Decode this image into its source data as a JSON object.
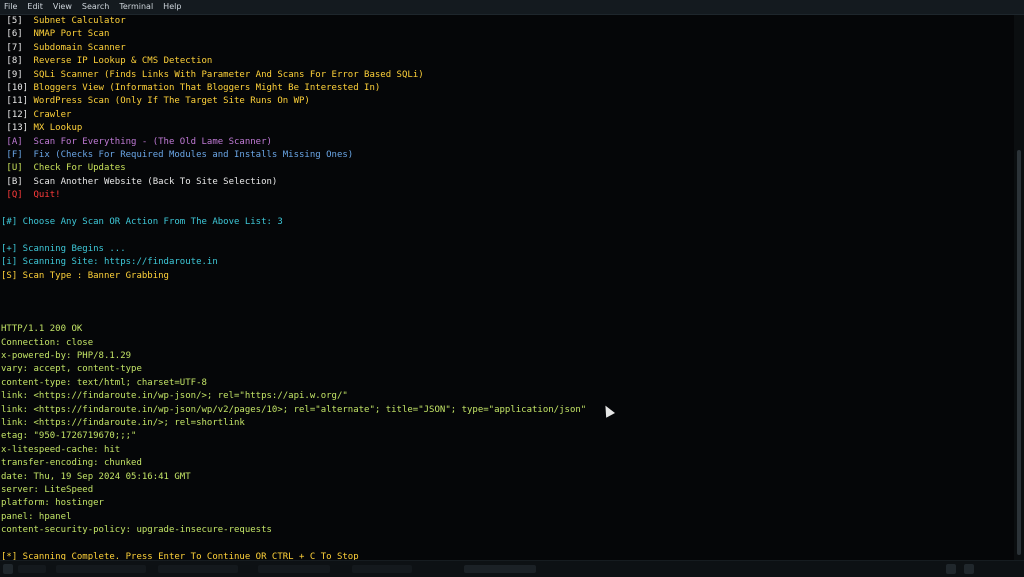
{
  "menubar": {
    "items": [
      "File",
      "Edit",
      "View",
      "Search",
      "Terminal",
      "Help"
    ]
  },
  "terminal": {
    "lines": [
      {
        "text": " [5]  Subnet Calculator",
        "color": "white-yellow"
      },
      {
        "text": " [6]  NMAP Port Scan",
        "color": "white-yellow"
      },
      {
        "text": " [7]  Subdomain Scanner",
        "color": "white-yellow"
      },
      {
        "text": " [8]  Reverse IP Lookup & CMS Detection",
        "color": "white-yellow"
      },
      {
        "text": " [9]  SQLi Scanner (Finds Links With Parameter And Scans For Error Based SQLi)",
        "color": "white-yellow"
      },
      {
        "text": " [10] Bloggers View (Information That Bloggers Might Be Interested In)",
        "color": "white-yellow"
      },
      {
        "text": " [11] WordPress Scan (Only If The Target Site Runs On WP)",
        "color": "white-yellow"
      },
      {
        "text": " [12] Crawler",
        "color": "white-yellow"
      },
      {
        "text": " [13] MX Lookup",
        "color": "white-yellow"
      },
      {
        "text": " [A]  Scan For Everything - (The Old Lame Scanner)",
        "color": "purple"
      },
      {
        "text": " [F]  Fix (Checks For Required Modules and Installs Missing Ones)",
        "color": "blue"
      },
      {
        "text": " [U]  Check For Updates",
        "color": "green"
      },
      {
        "text": " [B]  Scan Another Website (Back To Site Selection)",
        "color": "white"
      },
      {
        "text": " [Q]  Quit!",
        "color": "red"
      },
      {
        "text": "",
        "color": "white"
      },
      {
        "text": "[#] Choose Any Scan OR Action From The Above List: 3",
        "color": "cyan"
      },
      {
        "text": "",
        "color": "white"
      },
      {
        "text": "[+] Scanning Begins ...",
        "color": "cyan"
      },
      {
        "text": "[i] Scanning Site: https://findaroute.in",
        "color": "cyan"
      },
      {
        "text": "[S] Scan Type : Banner Grabbing",
        "color": "gold"
      },
      {
        "text": "",
        "color": "white"
      },
      {
        "text": "",
        "color": "white"
      },
      {
        "text": "",
        "color": "white"
      },
      {
        "text": "HTTP/1.1 200 OK",
        "color": "lime"
      },
      {
        "text": "Connection: close",
        "color": "lime"
      },
      {
        "text": "x-powered-by: PHP/8.1.29",
        "color": "lime"
      },
      {
        "text": "vary: accept, content-type",
        "color": "lime"
      },
      {
        "text": "content-type: text/html; charset=UTF-8",
        "color": "lime"
      },
      {
        "text": "link: <https://findaroute.in/wp-json/>; rel=\"https://api.w.org/\"",
        "color": "lime"
      },
      {
        "text": "link: <https://findaroute.in/wp-json/wp/v2/pages/10>; rel=\"alternate\"; title=\"JSON\"; type=\"application/json\"",
        "color": "lime"
      },
      {
        "text": "link: <https://findaroute.in/>; rel=shortlink",
        "color": "lime"
      },
      {
        "text": "etag: \"950-1726719670;;;\"",
        "color": "lime"
      },
      {
        "text": "x-litespeed-cache: hit",
        "color": "lime"
      },
      {
        "text": "transfer-encoding: chunked",
        "color": "lime"
      },
      {
        "text": "date: Thu, 19 Sep 2024 05:16:41 GMT",
        "color": "lime"
      },
      {
        "text": "server: LiteSpeed",
        "color": "lime"
      },
      {
        "text": "platform: hostinger",
        "color": "lime"
      },
      {
        "text": "panel: hpanel",
        "color": "lime"
      },
      {
        "text": "content-security-policy: upgrade-insecure-requests",
        "color": "lime"
      },
      {
        "text": "",
        "color": "white"
      },
      {
        "text": "[*] Scanning Complete. Press Enter To Continue OR CTRL + C To Stop",
        "color": "gold"
      }
    ]
  },
  "colors": {
    "background": "#050608",
    "white": "#e8e8e8",
    "yellow": "#ffd23a",
    "purple": "#c07ad6",
    "blue": "#6aa6e6",
    "green": "#c8e05a",
    "red": "#ff3b3b",
    "cyan": "#3ec8d8",
    "lime": "#c3e466",
    "gold": "#ffd23a"
  }
}
